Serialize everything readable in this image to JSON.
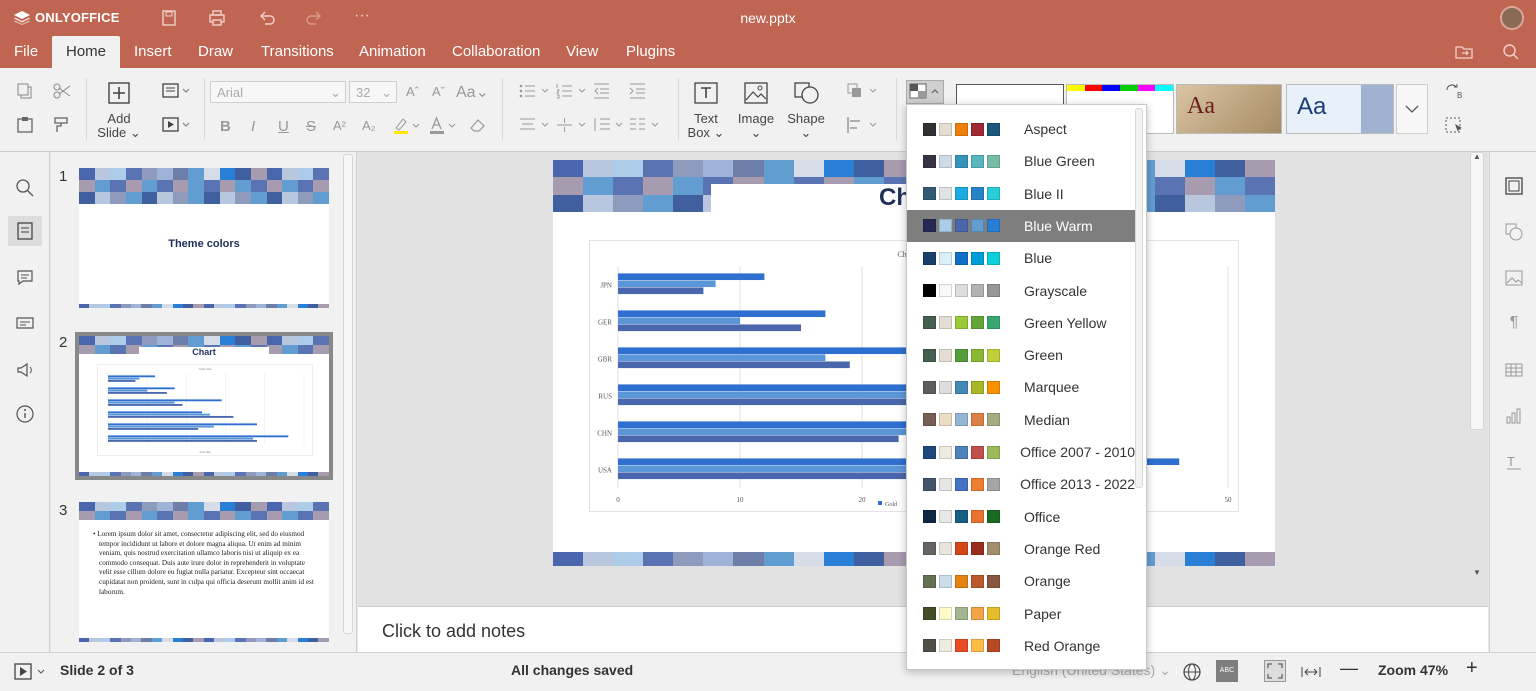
{
  "app": {
    "name": "ONLYOFFICE",
    "document_title": "new.pptx"
  },
  "menu_tabs": [
    "File",
    "Home",
    "Insert",
    "Draw",
    "Transitions",
    "Animation",
    "Collaboration",
    "View",
    "Plugins"
  ],
  "active_tab": "Home",
  "toolbar": {
    "add_slide_label": "Add Slide",
    "font_name_placeholder": "Arial",
    "font_size_placeholder": "32",
    "text_box_label": "Text Box",
    "image_label": "Image",
    "shape_label": "Shape",
    "bold": "B",
    "italic": "I",
    "underline": "U",
    "strikethrough": "S",
    "superscript": "A²",
    "subscript": "A₂",
    "font_grow": "Aˆ",
    "font_shrink": "Aˇ",
    "change_case": "Aa",
    "theme_preview_label": "Aa"
  },
  "color_schemes": {
    "selected": "Blue Warm",
    "items": [
      {
        "name": "Aspect",
        "colors": [
          "#323232",
          "#e3ded1",
          "#f07f09",
          "#9f2936",
          "#1b587c"
        ]
      },
      {
        "name": "Blue Green",
        "colors": [
          "#373545",
          "#cedbe6",
          "#3494ba",
          "#58b6c0",
          "#75bda7"
        ]
      },
      {
        "name": "Blue II",
        "colors": [
          "#335b74",
          "#dfe3e5",
          "#1cade4",
          "#2683c6",
          "#27ced7"
        ]
      },
      {
        "name": "Blue Warm",
        "colors": [
          "#242852",
          "#acccea",
          "#4a66ac",
          "#629dd1",
          "#297fd5"
        ]
      },
      {
        "name": "Blue",
        "colors": [
          "#17406d",
          "#dbeff9",
          "#0f6fc6",
          "#009dd9",
          "#0bd0d9"
        ]
      },
      {
        "name": "Grayscale",
        "colors": [
          "#000000",
          "#f8f8f8",
          "#dddddd",
          "#b2b2b2",
          "#969696"
        ]
      },
      {
        "name": "Green Yellow",
        "colors": [
          "#455f51",
          "#e3ded1",
          "#99cb38",
          "#63a537",
          "#37a76f"
        ]
      },
      {
        "name": "Green",
        "colors": [
          "#455f51",
          "#e3ded1",
          "#549e39",
          "#8ab833",
          "#c0cf3a"
        ]
      },
      {
        "name": "Marquee",
        "colors": [
          "#5e5e5e",
          "#dddddd",
          "#418ab3",
          "#a6b727",
          "#f69200"
        ]
      },
      {
        "name": "Median",
        "colors": [
          "#775f55",
          "#ebddc3",
          "#94b6d2",
          "#dd8047",
          "#a5ab81"
        ]
      },
      {
        "name": "Office 2007 - 2010",
        "colors": [
          "#1f497d",
          "#eeece1",
          "#4f81bd",
          "#c0504d",
          "#9bbb59"
        ]
      },
      {
        "name": "Office 2013 - 2022",
        "colors": [
          "#44546a",
          "#e7e6e6",
          "#4472c4",
          "#ed7d31",
          "#a5a5a5"
        ]
      },
      {
        "name": "Office",
        "colors": [
          "#0e2841",
          "#e8e8e8",
          "#156082",
          "#e97132",
          "#196b24"
        ]
      },
      {
        "name": "Orange Red",
        "colors": [
          "#696464",
          "#e9e5dc",
          "#d34817",
          "#9b2d1f",
          "#a28e6a"
        ]
      },
      {
        "name": "Orange",
        "colors": [
          "#637052",
          "#ccddea",
          "#e48312",
          "#bd582c",
          "#865640"
        ]
      },
      {
        "name": "Paper",
        "colors": [
          "#444d26",
          "#fefac9",
          "#a5b592",
          "#f3a447",
          "#e7bc29"
        ]
      },
      {
        "name": "Red Orange",
        "colors": [
          "#505046",
          "#eeece1",
          "#e84c22",
          "#ffbd47",
          "#b64926"
        ]
      }
    ]
  },
  "slides_panel": {
    "slides": [
      {
        "number": "1",
        "title": "Theme colors"
      },
      {
        "number": "2",
        "title": "Chart",
        "chart_caption": "Chart title",
        "axis_caption": "Axis title"
      },
      {
        "number": "3",
        "body": "Lorem ipsum dolor sit amet, consectetur adipiscing elit, sed do eiusmod tempor incididunt ut labore et dolore magna aliqua. Ut enim ad minim veniam, quis nostrud exercitation ullamco laboris nisi ut aliquip ex ea commodo consequat. Duis aute irure dolor in reprehenderit in voluptate velit esse cillum dolore eu fugiat nulla pariatur. Excepteur sint occaecat cupidatat non proident, sunt in culpa qui officia deserunt mollit anim id est laborum."
      }
    ]
  },
  "slide": {
    "title_visible": "Ch",
    "chart_title_visible": "Ch"
  },
  "chart_data": {
    "type": "bar",
    "orientation": "horizontal",
    "categories": [
      "USA",
      "CHN",
      "RUS",
      "GBR",
      "GER",
      "JPN"
    ],
    "series": [
      {
        "name": "Gold",
        "values": [
          46,
          38,
          24,
          29,
          17,
          12
        ]
      },
      {
        "name": "",
        "values": [
          37,
          27,
          26,
          17,
          10,
          8
        ]
      },
      {
        "name": "",
        "values": [
          38,
          23,
          32,
          19,
          15,
          7
        ]
      }
    ],
    "x_ticks": [
      "0",
      "10",
      "20",
      "30",
      "40",
      "50"
    ],
    "xlim": [
      0,
      50
    ],
    "colors": [
      "#2e6fd0",
      "#5b96d8",
      "#4a66ac"
    ],
    "legend": "bottom"
  },
  "notes_placeholder": "Click to add notes",
  "status": {
    "slide_indicator": "Slide 2 of 3",
    "save_status": "All changes saved",
    "language": "English (United States)",
    "zoom": "Zoom 47%",
    "spell_badge": "ABC"
  }
}
